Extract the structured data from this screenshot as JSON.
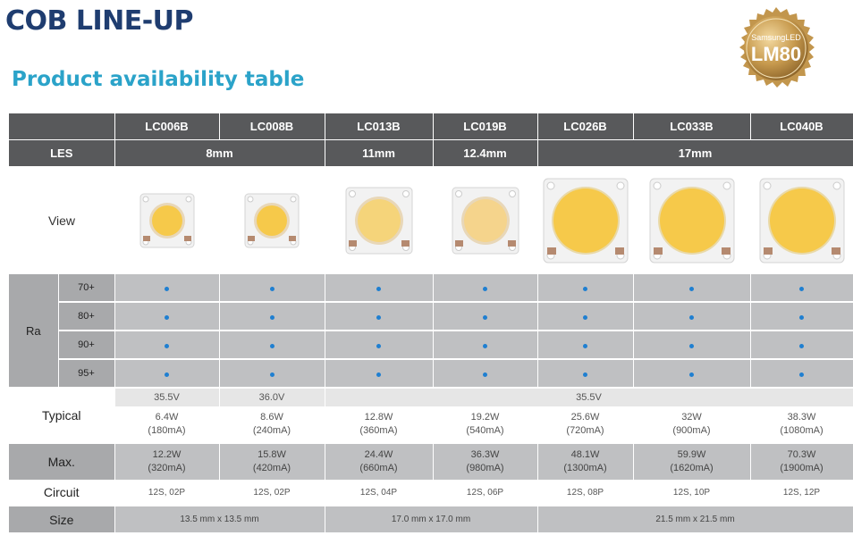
{
  "header": {
    "title": "COB LINE-UP",
    "subtitle": "Product availability table"
  },
  "badge": {
    "line1": "SamsungLED",
    "line2": "LM80"
  },
  "products": [
    "LC006B",
    "LC008B",
    "LC013B",
    "LC019B",
    "LC026B",
    "LC033B",
    "LC040B"
  ],
  "labels": {
    "les": "LES",
    "view": "View",
    "ra": "Ra",
    "typical": "Typical",
    "max": "Max.",
    "circuit": "Circuit",
    "size": "Size"
  },
  "les": {
    "g1": "8mm",
    "g2": "11mm",
    "g3": "12.4mm",
    "g4": "17mm"
  },
  "ra_levels": [
    "70+",
    "80+",
    "90+",
    "95+"
  ],
  "typical_voltage": {
    "v1": "35.5V",
    "v2": "36.0V",
    "v3": "35.5V"
  },
  "typical_power": [
    {
      "w": "6.4W",
      "ma": "(180mA)"
    },
    {
      "w": "8.6W",
      "ma": "(240mA)"
    },
    {
      "w": "12.8W",
      "ma": "(360mA)"
    },
    {
      "w": "19.2W",
      "ma": "(540mA)"
    },
    {
      "w": "25.6W",
      "ma": "(720mA)"
    },
    {
      "w": "32W",
      "ma": "(900mA)"
    },
    {
      "w": "38.3W",
      "ma": "(1080mA)"
    }
  ],
  "max_power": [
    {
      "w": "12.2W",
      "ma": "(320mA)"
    },
    {
      "w": "15.8W",
      "ma": "(420mA)"
    },
    {
      "w": "24.4W",
      "ma": "(660mA)"
    },
    {
      "w": "36.3W",
      "ma": "(980mA)"
    },
    {
      "w": "48.1W",
      "ma": "(1300mA)"
    },
    {
      "w": "59.9W",
      "ma": "(1620mA)"
    },
    {
      "w": "70.3W",
      "ma": "(1900mA)"
    }
  ],
  "circuit": [
    "12S, 02P",
    "12S, 02P",
    "12S, 04P",
    "12S, 06P",
    "12S, 08P",
    "12S, 10P",
    "12S, 12P"
  ],
  "size": {
    "s1": "13.5 mm x 13.5 mm",
    "s2": "17.0 mm x 17.0 mm",
    "s3": "21.5 mm x 21.5 mm"
  },
  "colors": {
    "header_bg": "#58595b",
    "title": "#1f3d70",
    "subtitle": "#2ba3c9",
    "dot": "#1f7fd1",
    "phosphor": "#f6c94a"
  }
}
